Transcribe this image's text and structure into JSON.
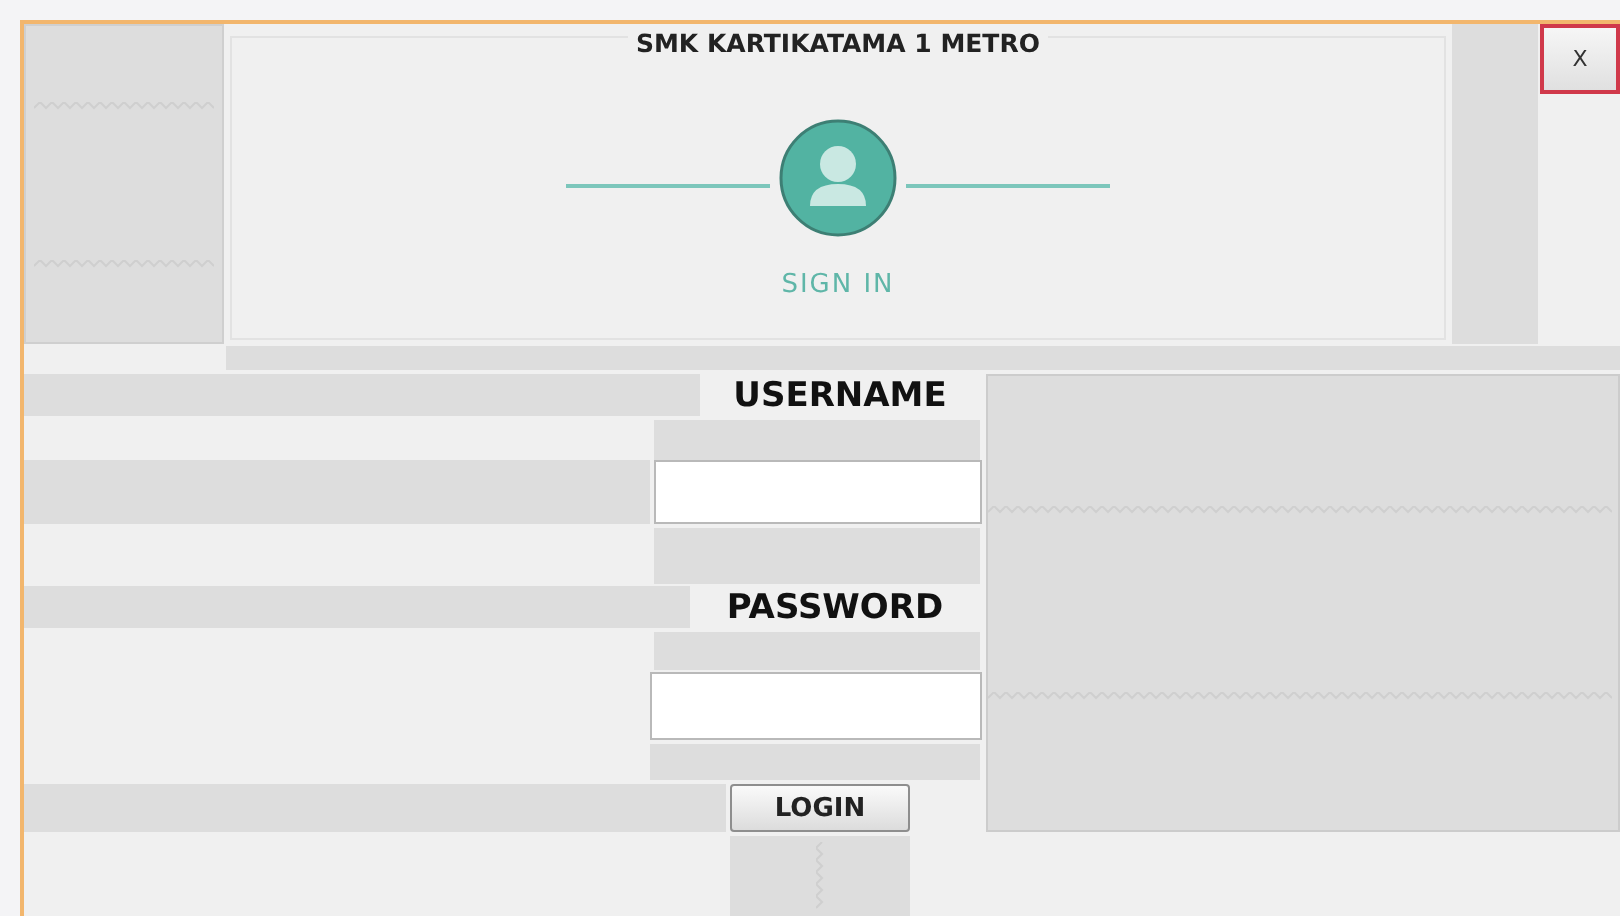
{
  "window": {
    "title": "SMK KARTIKATAMA 1 METRO",
    "close_button": "X"
  },
  "header": {
    "caption": "SIGN IN"
  },
  "form": {
    "username_label": "USERNAME",
    "password_label": "PASSWORD",
    "login_button": "LOGIN"
  }
}
